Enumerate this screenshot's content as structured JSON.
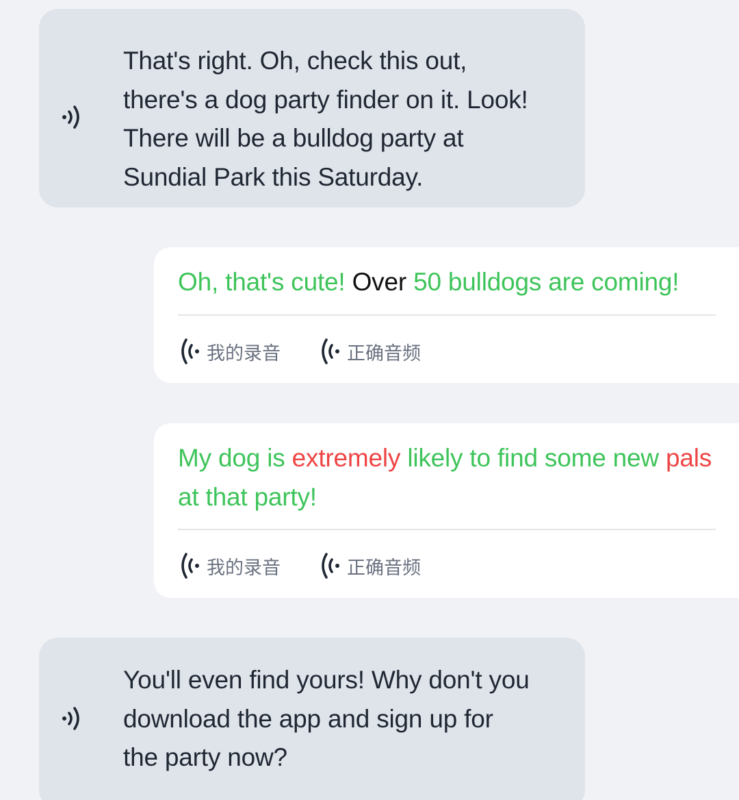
{
  "colors": {
    "background": "#f0f2f5",
    "incoming_bubble": "#dfe3ea",
    "outgoing_bubble": "#ffffff",
    "correct_word": "#3ec45a",
    "wrong_word": "#ee4545",
    "neutral_word": "#111111",
    "incoming_text": "#1f2733"
  },
  "messages": {
    "m1": {
      "icon": "speaker-icon",
      "lines": [
        "That's right. Oh, check this out,",
        "there's a dog party finder on it. Look!",
        "There will be a bulldog party at",
        "Sundial Park this Saturday."
      ]
    },
    "m2": {
      "w1": "Oh, that's cute!",
      "w2": "Over",
      "w3": "50 bulldogs are coming!",
      "my_recording": "我的录音",
      "correct_audio": "正确音频"
    },
    "m3": {
      "w1": "My dog is",
      "w2": "extremely",
      "w3": "likely to find some new",
      "w4": "pals",
      "w5": "at that party!",
      "my_recording": "我的录音",
      "correct_audio": "正确音频"
    },
    "m4": {
      "icon": "speaker-icon",
      "lines": [
        "You'll even find yours! Why don't you",
        "download the app and sign up for",
        "the party now?"
      ]
    }
  }
}
